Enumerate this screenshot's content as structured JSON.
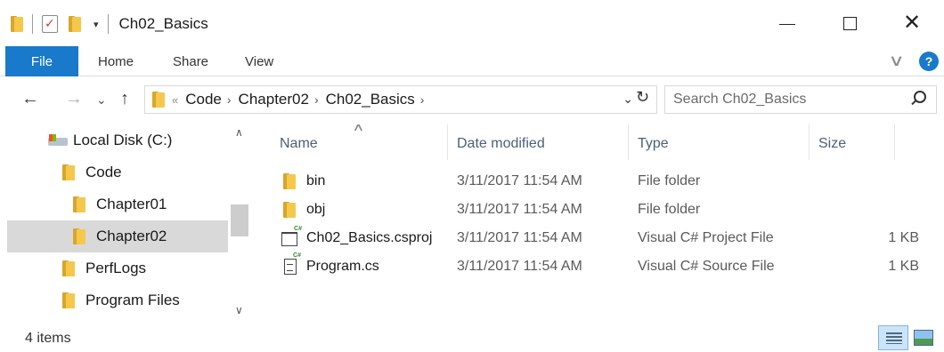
{
  "window": {
    "title": "Ch02_Basics",
    "qat_dropdown": "▾",
    "minimize_icon": "minimize-icon",
    "maximize_icon": "maximize-icon",
    "close_glyph": "✕"
  },
  "ribbon": {
    "tabs": [
      {
        "label": "File",
        "active": true
      },
      {
        "label": "Home"
      },
      {
        "label": "Share"
      },
      {
        "label": "View"
      }
    ],
    "expand_glyph": "∨",
    "help_glyph": "?",
    "accent_color": "#1979ca"
  },
  "navigation": {
    "back_glyph": "←",
    "forward_glyph": "→",
    "recent_glyph": "⌄",
    "up_glyph": "↑",
    "breadcrumb_start": "«",
    "breadcrumb": [
      "Code",
      "Chapter02",
      "Ch02_Basics"
    ],
    "breadcrumb_sep": "›",
    "address_dropdown": "⌄",
    "refresh_glyph": "↻",
    "search_placeholder": "Search Ch02_Basics"
  },
  "tree": {
    "items": [
      {
        "label": "Local Disk (C:)",
        "icon": "drive-icon"
      },
      {
        "label": "Code",
        "icon": "folder-icon"
      },
      {
        "label": "Chapter01",
        "icon": "folder-icon"
      },
      {
        "label": "Chapter02",
        "icon": "folder-icon",
        "selected": true
      },
      {
        "label": "PerfLogs",
        "icon": "folder-icon"
      },
      {
        "label": "Program Files",
        "icon": "folder-icon"
      }
    ],
    "scroll_up_glyph": "∧",
    "scroll_down_glyph": "∨"
  },
  "files": {
    "sort_glyph": "∧",
    "columns": {
      "name": "Name",
      "date": "Date modified",
      "type": "Type",
      "size": "Size"
    },
    "rows": [
      {
        "name": "bin",
        "date": "3/11/2017 11:54 AM",
        "type": "File folder",
        "size": "",
        "icon": "folder-icon"
      },
      {
        "name": "obj",
        "date": "3/11/2017 11:54 AM",
        "type": "File folder",
        "size": "",
        "icon": "folder-icon"
      },
      {
        "name": "Ch02_Basics.csproj",
        "date": "3/11/2017 11:54 AM",
        "type": "Visual C# Project File",
        "size": "1 KB",
        "icon": "csproj-file-icon"
      },
      {
        "name": "Program.cs",
        "date": "3/11/2017 11:54 AM",
        "type": "Visual C# Source File",
        "size": "1 KB",
        "icon": "cs-file-icon"
      }
    ]
  },
  "status": {
    "item_count": "4 items"
  }
}
